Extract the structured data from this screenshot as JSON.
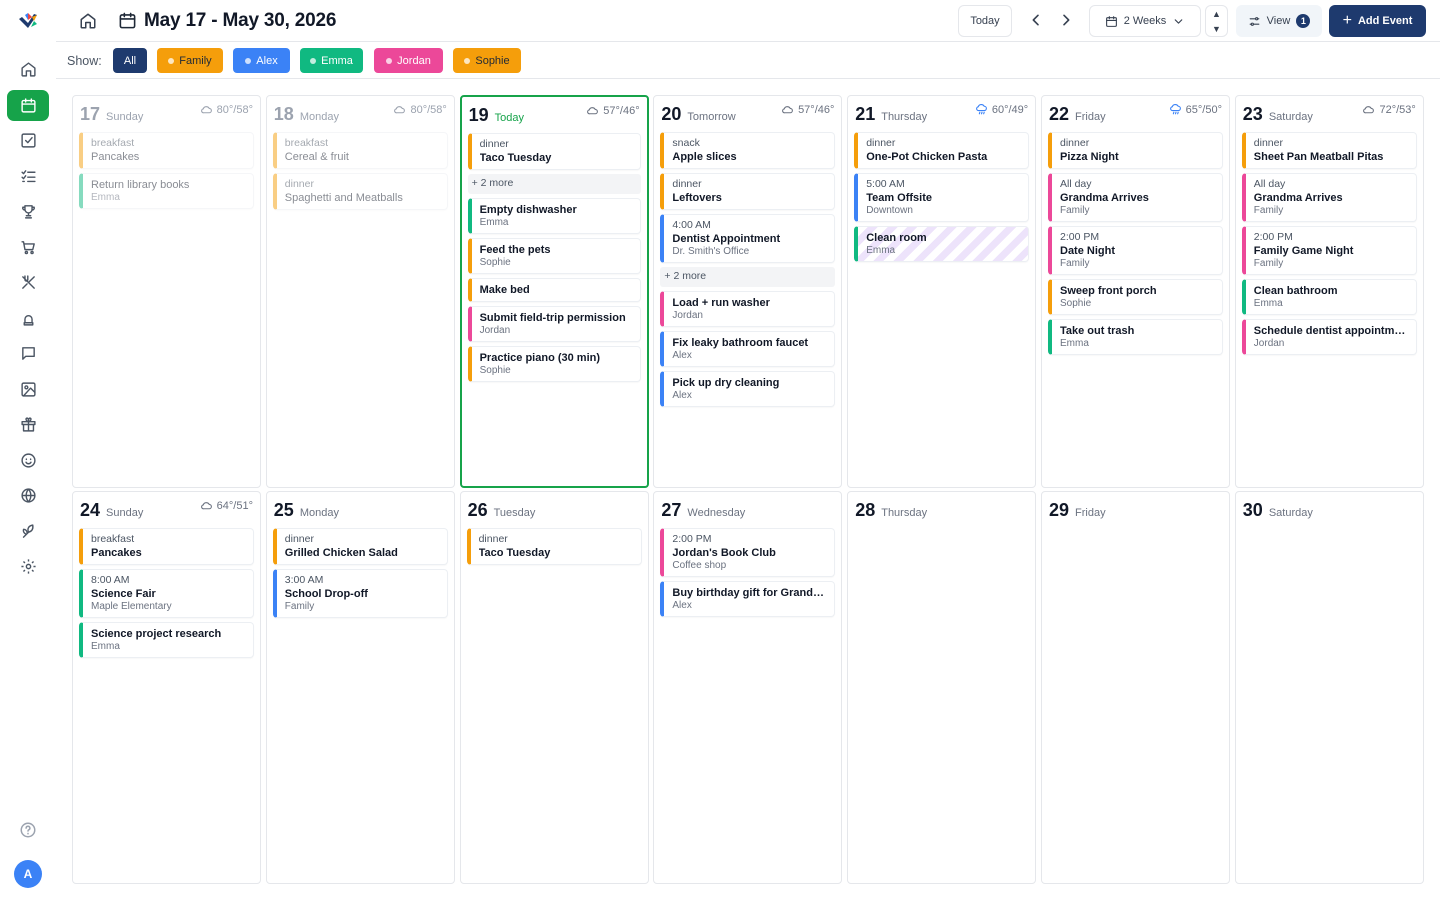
{
  "header": {
    "range_title": "May 17 - May 30, 2026",
    "today_label": "Today",
    "view_span_label": "2 Weeks",
    "stepper_up": "▲",
    "stepper_down": "▼",
    "view_label": "View",
    "view_count": "1",
    "add_event_label": "Add Event"
  },
  "filters": {
    "show_label": "Show:",
    "chips": [
      {
        "label": "All",
        "color": "#1e3a6e"
      },
      {
        "label": "Family",
        "color": "#f59e0b"
      },
      {
        "label": "Alex",
        "color": "#3b82f6"
      },
      {
        "label": "Emma",
        "color": "#10b981"
      },
      {
        "label": "Jordan",
        "color": "#ec4899"
      },
      {
        "label": "Sophie",
        "color": "#f59e0b"
      }
    ]
  },
  "sidebar": {
    "icons": [
      "home-icon",
      "calendar-icon",
      "tasks-icon",
      "checklist-icon",
      "trophy-icon",
      "cart-icon",
      "meals-icon",
      "recipes-icon",
      "messages-icon",
      "photos-icon",
      "gift-icon",
      "face-icon",
      "globe-icon",
      "plants-icon",
      "settings-icon"
    ],
    "active": "calendar-icon",
    "help_icon": "help-icon",
    "avatar_initial": "A"
  },
  "colors": {
    "accent_green": "#16a34a",
    "navy": "#1e3a6e",
    "family": "#f59e0b",
    "alex": "#3b82f6",
    "emma": "#10b981",
    "jordan": "#ec4899",
    "sophie": "#f59e0b"
  },
  "days": [
    {
      "num": "17",
      "name": "Sunday",
      "weather": "80°/58°",
      "past": true,
      "events": [
        {
          "sub1": "breakfast",
          "title": "Pancakes",
          "person": "family",
          "faded": true
        },
        {
          "title": "Return library books",
          "sub2": "Emma",
          "person": "emma",
          "faded": true
        }
      ]
    },
    {
      "num": "18",
      "name": "Monday",
      "weather": "80°/58°",
      "weather_icon": "cloud-icon",
      "past": true,
      "events": [
        {
          "sub1": "breakfast",
          "title": "Cereal & fruit",
          "person": "family",
          "faded": true
        },
        {
          "sub1": "dinner",
          "title": "Spaghetti and Meatballs",
          "person": "family",
          "faded": true
        }
      ]
    },
    {
      "num": "19",
      "name": "Today",
      "weather": "57°/46°",
      "weather_icon": "cloud-icon",
      "today": true,
      "events": [
        {
          "sub1": "dinner",
          "title": "Taco Tuesday",
          "person": "family"
        },
        {
          "more": "+ 2 more"
        },
        {
          "title": "Empty dishwasher",
          "sub2": "Emma",
          "person": "emma"
        },
        {
          "title": "Feed the pets",
          "sub2": "Sophie",
          "person": "sophie"
        },
        {
          "title": "Make bed",
          "person": "sophie"
        },
        {
          "title": "Submit field-trip permission",
          "sub2": "Jordan",
          "person": "jordan"
        },
        {
          "title": "Practice piano (30 min)",
          "sub2": "Sophie",
          "person": "sophie"
        }
      ]
    },
    {
      "num": "20",
      "name": "Tomorrow",
      "weather": "57°/46°",
      "weather_icon": "cloud-icon",
      "events": [
        {
          "sub1": "snack",
          "title": "Apple slices",
          "person": "family"
        },
        {
          "sub1": "dinner",
          "title": "Leftovers",
          "person": "family"
        },
        {
          "sub1": "4:00 AM",
          "title": "Dentist Appointment",
          "sub2": "Dr. Smith's Office",
          "person": "alex"
        },
        {
          "more": "+ 2 more"
        },
        {
          "title": "Load + run washer",
          "sub2": "Jordan",
          "person": "jordan"
        },
        {
          "title": "Fix leaky bathroom faucet",
          "sub2": "Alex",
          "person": "alex"
        },
        {
          "title": "Pick up dry cleaning",
          "sub2": "Alex",
          "person": "alex"
        }
      ]
    },
    {
      "num": "21",
      "name": "Thursday",
      "weather": "60°/49°",
      "weather_icon": "rain-icon",
      "events": [
        {
          "sub1": "dinner",
          "title": "One-Pot Chicken Pasta",
          "person": "family"
        },
        {
          "sub1": "5:00 AM",
          "title": "Team Offsite",
          "sub2": "Downtown",
          "person": "alex"
        },
        {
          "title": "Clean room",
          "sub2": "Emma",
          "person": "emma",
          "striped": true
        }
      ]
    },
    {
      "num": "22",
      "name": "Friday",
      "weather": "65°/50°",
      "weather_icon": "rain-icon",
      "events": [
        {
          "sub1": "dinner",
          "title": "Pizza Night",
          "person": "family"
        },
        {
          "sub1": "All day",
          "title": "Grandma Arrives",
          "sub2": "Family",
          "person": "jordan"
        },
        {
          "sub1": "2:00 PM",
          "title": "Date Night",
          "sub2": "Family",
          "person": "jordan"
        },
        {
          "title": "Sweep front porch",
          "sub2": "Sophie",
          "person": "sophie"
        },
        {
          "title": "Take out trash",
          "sub2": "Emma",
          "person": "emma"
        }
      ]
    },
    {
      "num": "23",
      "name": "Saturday",
      "weather": "72°/53°",
      "weather_icon": "cloud-icon",
      "events": [
        {
          "sub1": "dinner",
          "title": "Sheet Pan Meatball Pitas",
          "person": "family"
        },
        {
          "sub1": "All day",
          "title": "Grandma Arrives",
          "sub2": "Family",
          "person": "jordan"
        },
        {
          "sub1": "2:00 PM",
          "title": "Family Game Night",
          "sub2": "Family",
          "person": "jordan"
        },
        {
          "title": "Clean bathroom",
          "sub2": "Emma",
          "person": "emma"
        },
        {
          "title": "Schedule dentist appointme...",
          "sub2": "Jordan",
          "person": "jordan"
        }
      ]
    },
    {
      "num": "24",
      "name": "Sunday",
      "weather": "64°/51°",
      "weather_icon": "cloud-icon",
      "events": [
        {
          "sub1": "breakfast",
          "title": "Pancakes",
          "person": "family"
        },
        {
          "sub1": "8:00 AM",
          "title": "Science Fair",
          "sub2": "Maple Elementary",
          "person": "emma"
        },
        {
          "title": "Science project research",
          "sub2": "Emma",
          "person": "emma"
        }
      ]
    },
    {
      "num": "25",
      "name": "Monday",
      "events": [
        {
          "sub1": "dinner",
          "title": "Grilled Chicken Salad",
          "person": "family"
        },
        {
          "sub1": "3:00 AM",
          "title": "School Drop-off",
          "sub2": "Family",
          "person": "alex"
        }
      ]
    },
    {
      "num": "26",
      "name": "Tuesday",
      "events": [
        {
          "sub1": "dinner",
          "title": "Taco Tuesday",
          "person": "family"
        }
      ]
    },
    {
      "num": "27",
      "name": "Wednesday",
      "events": [
        {
          "sub1": "2:00 PM",
          "title": "Jordan's Book Club",
          "sub2": "Coffee shop",
          "person": "jordan"
        },
        {
          "title": "Buy birthday gift for Grandma",
          "sub2": "Alex",
          "person": "alex"
        }
      ]
    },
    {
      "num": "28",
      "name": "Thursday",
      "events": []
    },
    {
      "num": "29",
      "name": "Friday",
      "events": []
    },
    {
      "num": "30",
      "name": "Saturday",
      "events": []
    }
  ]
}
